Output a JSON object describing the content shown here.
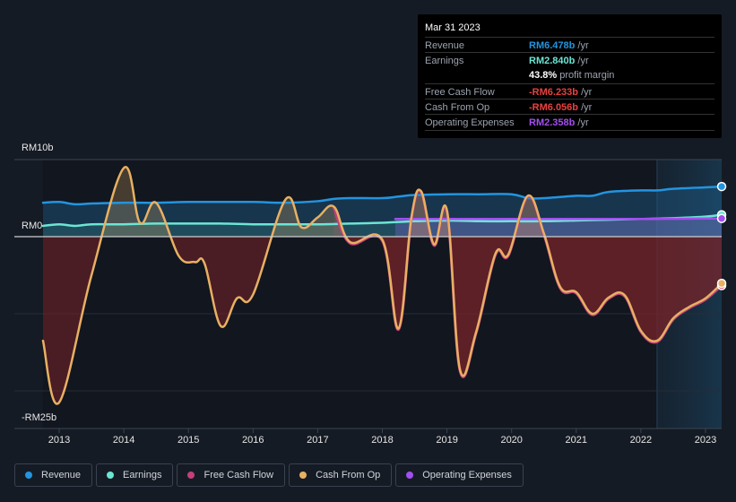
{
  "tooltip": {
    "date": "Mar 31 2023",
    "rows": [
      {
        "label": "Revenue",
        "value": "RM6.478b",
        "unit": " /yr",
        "color": "#2394df"
      },
      {
        "label": "Earnings",
        "value": "RM2.840b",
        "unit": " /yr",
        "color": "#6ce5d4"
      },
      {
        "label": "",
        "value": "43.8%",
        "unit": " profit margin",
        "color": "#ffffff"
      },
      {
        "label": "Free Cash Flow",
        "value": "-RM6.233b",
        "unit": " /yr",
        "color": "#e8413f"
      },
      {
        "label": "Cash From Op",
        "value": "-RM6.056b",
        "unit": " /yr",
        "color": "#e8413f"
      },
      {
        "label": "Operating Expenses",
        "value": "RM2.358b",
        "unit": " /yr",
        "color": "#a24ff0"
      }
    ]
  },
  "legend": [
    {
      "label": "Revenue",
      "color": "#2394df"
    },
    {
      "label": "Earnings",
      "color": "#6ce5d4"
    },
    {
      "label": "Free Cash Flow",
      "color": "#c2407c"
    },
    {
      "label": "Cash From Op",
      "color": "#e8b062"
    },
    {
      "label": "Operating Expenses",
      "color": "#a24ff0"
    }
  ],
  "chart_data": {
    "type": "line",
    "title": "",
    "xlabel": "",
    "ylabel": "",
    "ylim": [
      -25,
      10
    ],
    "y_unit": "RM b",
    "y_tick_labels": [
      {
        "value": 10,
        "label": "RM10b"
      },
      {
        "value": 0,
        "label": "RM0"
      },
      {
        "value": -25,
        "label": "-RM25b"
      }
    ],
    "y_gridlines": [
      10,
      0,
      -10,
      -20
    ],
    "xlim": [
      2012.3,
      2023.25
    ],
    "x_tick_labels": [
      "2013",
      "2014",
      "2015",
      "2016",
      "2017",
      "2018",
      "2019",
      "2020",
      "2021",
      "2022",
      "2023"
    ],
    "x_ticks": [
      2013,
      2014,
      2015,
      2016,
      2017,
      2018,
      2019,
      2020,
      2021,
      2022,
      2023
    ],
    "forecast_shade_start": 2022.25,
    "grid": true,
    "legend_position": "bottom",
    "series": [
      {
        "name": "Revenue",
        "color": "#2394df",
        "x": [
          2012.75,
          2013.0,
          2013.25,
          2013.5,
          2014.0,
          2014.5,
          2015.0,
          2015.5,
          2016.0,
          2016.5,
          2017.0,
          2017.25,
          2017.5,
          2018.0,
          2018.25,
          2018.5,
          2019.0,
          2019.5,
          2020.0,
          2020.25,
          2020.5,
          2021.0,
          2021.25,
          2021.5,
          2022.0,
          2022.25,
          2022.5,
          2023.0,
          2023.25
        ],
        "values": [
          4.4,
          4.5,
          4.2,
          4.3,
          4.4,
          4.4,
          4.5,
          4.5,
          4.5,
          4.4,
          4.6,
          4.9,
          5.0,
          5.0,
          5.2,
          5.4,
          5.5,
          5.5,
          5.5,
          5.0,
          5.0,
          5.3,
          5.3,
          5.8,
          6.0,
          6.0,
          6.2,
          6.4,
          6.5
        ]
      },
      {
        "name": "Earnings",
        "color": "#6ce5d4",
        "x": [
          2012.75,
          2013.0,
          2013.25,
          2013.5,
          2014.0,
          2014.5,
          2015.0,
          2015.5,
          2016.0,
          2016.5,
          2017.0,
          2017.5,
          2018.0,
          2018.5,
          2019.0,
          2019.5,
          2020.0,
          2020.5,
          2021.0,
          2021.5,
          2022.0,
          2022.5,
          2023.0,
          2023.25
        ],
        "values": [
          1.4,
          1.6,
          1.4,
          1.6,
          1.6,
          1.7,
          1.7,
          1.7,
          1.6,
          1.6,
          1.6,
          1.7,
          1.8,
          2.0,
          2.1,
          2.0,
          2.0,
          2.0,
          2.1,
          2.2,
          2.3,
          2.4,
          2.6,
          2.84
        ]
      },
      {
        "name": "Free Cash Flow",
        "color": "#c2407c",
        "x": [
          2017.25,
          2017.5,
          2018.0,
          2018.25,
          2018.45,
          2018.6,
          2018.8,
          2019.0,
          2019.2,
          2019.45,
          2019.75,
          2019.95,
          2020.25,
          2020.5,
          2020.75,
          2021.0,
          2021.25,
          2021.5,
          2021.75,
          2022.0,
          2022.25,
          2022.5,
          2022.75,
          2023.0,
          2023.25
        ],
        "values": [
          3.9,
          -0.7,
          -0.4,
          -11.9,
          2.5,
          5.9,
          -1.0,
          3.4,
          -17.2,
          -12.4,
          -2.2,
          -2.3,
          5.3,
          0.4,
          -6.5,
          -7.2,
          -10.0,
          -7.9,
          -7.6,
          -12.2,
          -13.5,
          -10.6,
          -9.1,
          -8.0,
          -6.2
        ]
      },
      {
        "name": "Cash From Op",
        "color": "#e8b062",
        "x": [
          2012.75,
          2013.0,
          2013.5,
          2014.0,
          2014.25,
          2014.5,
          2014.85,
          2015.1,
          2015.25,
          2015.5,
          2015.75,
          2016.0,
          2016.5,
          2016.75,
          2017.0,
          2017.25,
          2017.5,
          2018.0,
          2018.25,
          2018.45,
          2018.6,
          2018.8,
          2019.0,
          2019.2,
          2019.45,
          2019.75,
          2019.95,
          2020.25,
          2020.5,
          2020.75,
          2021.0,
          2021.25,
          2021.5,
          2021.75,
          2022.0,
          2022.25,
          2022.5,
          2022.75,
          2023.0,
          2023.25
        ],
        "values": [
          -13.5,
          -21.5,
          -5.0,
          8.9,
          1.8,
          4.4,
          -2.5,
          -3.3,
          -3.5,
          -11.6,
          -8.0,
          -7.5,
          4.8,
          1.2,
          2.5,
          3.9,
          -0.7,
          -0.4,
          -11.9,
          2.5,
          5.9,
          -1.0,
          3.4,
          -17.2,
          -12.4,
          -2.2,
          -2.3,
          5.3,
          0.4,
          -6.5,
          -7.2,
          -10.0,
          -7.9,
          -7.6,
          -12.2,
          -13.5,
          -10.6,
          -9.1,
          -8.0,
          -6.056
        ]
      },
      {
        "name": "Operating Expenses",
        "color": "#a24ff0",
        "x": [
          2018.2,
          2019.0,
          2020.0,
          2021.0,
          2022.0,
          2023.0,
          2023.25
        ],
        "values": [
          2.3,
          2.3,
          2.3,
          2.3,
          2.3,
          2.35,
          2.358
        ]
      }
    ]
  }
}
